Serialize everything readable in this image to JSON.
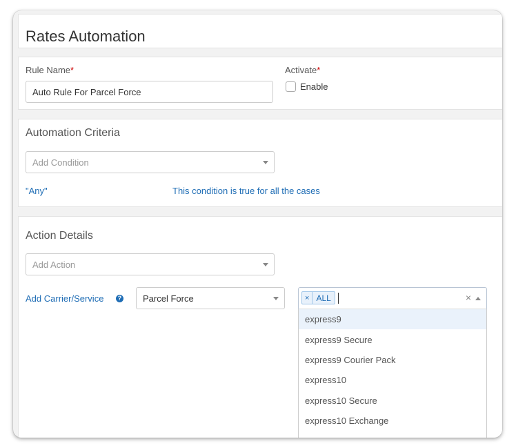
{
  "page": {
    "title": "Rates Automation"
  },
  "rule": {
    "name_label": "Rule Name",
    "required_mark": "*",
    "name_value": "Auto Rule For Parcel Force",
    "activate_label": "Activate",
    "enable_label": "Enable",
    "enable_checked": false
  },
  "criteria": {
    "title": "Automation Criteria",
    "condition_placeholder": "Add Condition",
    "any_label": "\"Any\"",
    "any_description": "This condition is true for all the cases"
  },
  "action": {
    "title": "Action Details",
    "action_placeholder": "Add Action",
    "carrier_label": "Add Carrier/Service",
    "help_glyph": "?",
    "carrier_value": "Parcel Force",
    "services": {
      "selected_tags": [
        {
          "remove": "×",
          "label": "ALL"
        }
      ],
      "clear_glyph": "×",
      "options": [
        "express9",
        "express9 Secure",
        "express9 Courier Pack",
        "express10",
        "express10 Secure",
        "express10 Exchange"
      ],
      "highlighted_index": 0
    }
  },
  "colors": {
    "link": "#1f6db5",
    "required": "#cc0000",
    "highlight": "#eaf2fb"
  }
}
